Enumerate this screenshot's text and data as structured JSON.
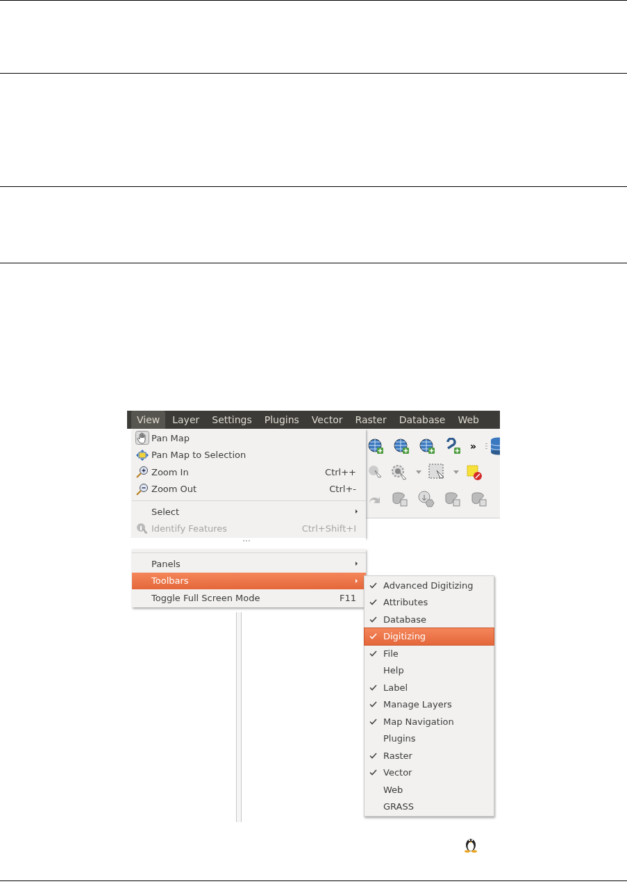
{
  "menu_bar": {
    "items": [
      {
        "label": "View",
        "selected": true
      },
      {
        "label": "Layer",
        "selected": false
      },
      {
        "label": "Settings",
        "selected": false
      },
      {
        "label": "Plugins",
        "selected": false
      },
      {
        "label": "Vector",
        "selected": false
      },
      {
        "label": "Raster",
        "selected": false
      },
      {
        "label": "Database",
        "selected": false
      },
      {
        "label": "Web",
        "selected": false
      }
    ]
  },
  "toolbar": {
    "overflow": "»"
  },
  "view_menu": {
    "groups": [
      {
        "items": [
          {
            "label": "Pan Map",
            "kind": "action",
            "disabled": false,
            "selected": false
          },
          {
            "label": "Pan Map to Selection",
            "kind": "action",
            "disabled": false,
            "selected": false
          },
          {
            "label": "Zoom In",
            "shortcut": "Ctrl++",
            "kind": "action",
            "disabled": false,
            "selected": false
          },
          {
            "label": "Zoom Out",
            "shortcut": "Ctrl+-",
            "kind": "action",
            "disabled": false,
            "selected": false
          }
        ]
      },
      {
        "items": [
          {
            "label": "Select",
            "kind": "submenu",
            "disabled": false,
            "selected": false
          },
          {
            "label": "Identify Features",
            "shortcut": "Ctrl+Shift+I",
            "kind": "action",
            "disabled": true,
            "selected": false
          }
        ]
      },
      {
        "elision": "···",
        "items": [
          {
            "label": "Panels",
            "kind": "submenu",
            "disabled": false,
            "selected": false
          },
          {
            "label": "Toolbars",
            "kind": "submenu",
            "disabled": false,
            "selected": true
          },
          {
            "label": "Toggle Full Screen Mode",
            "shortcut": "F11",
            "kind": "action",
            "disabled": false,
            "selected": false
          }
        ]
      }
    ]
  },
  "toolbars_menu": {
    "items": [
      {
        "label": "Advanced Digitizing",
        "checked": true,
        "selected": false
      },
      {
        "label": "Attributes",
        "checked": true,
        "selected": false
      },
      {
        "label": "Database",
        "checked": true,
        "selected": false
      },
      {
        "label": "Digitizing",
        "checked": true,
        "selected": true
      },
      {
        "label": "File",
        "checked": true,
        "selected": false
      },
      {
        "label": "Help",
        "checked": false,
        "selected": false
      },
      {
        "label": "Label",
        "checked": true,
        "selected": false
      },
      {
        "label": "Manage Layers",
        "checked": true,
        "selected": false
      },
      {
        "label": "Map Navigation",
        "checked": true,
        "selected": false
      },
      {
        "label": "Plugins",
        "checked": false,
        "selected": false
      },
      {
        "label": "Raster",
        "checked": true,
        "selected": false
      },
      {
        "label": "Vector",
        "checked": true,
        "selected": false
      },
      {
        "label": "Web",
        "checked": false,
        "selected": false
      },
      {
        "label": "GRASS",
        "checked": false,
        "selected": false
      }
    ]
  }
}
